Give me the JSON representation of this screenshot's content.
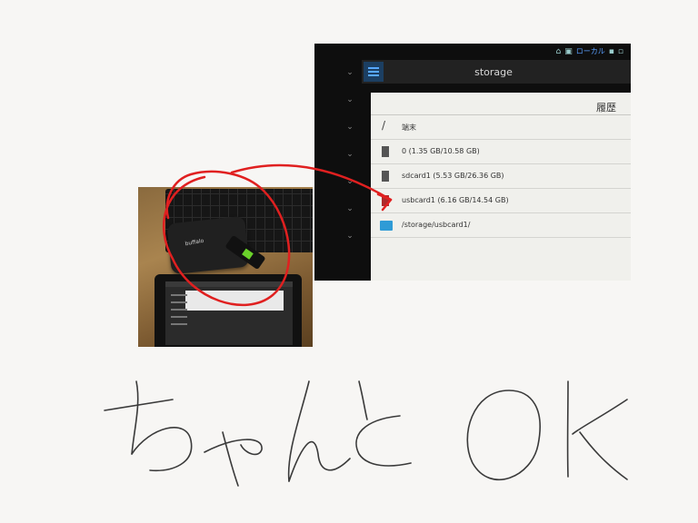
{
  "tablet_window": {
    "status_bar": {
      "text": "ローカル"
    },
    "app_bar": {
      "title": "storage"
    },
    "dialog": {
      "title": "履歴",
      "items": [
        {
          "label": "端末",
          "icon": "slash-icon"
        },
        {
          "label": "0 (1.35 GB/10.58 GB)",
          "icon": "storage-icon"
        },
        {
          "label": "sdcard1 (5.53 GB/26.36 GB)",
          "icon": "sdcard-icon"
        },
        {
          "label": "usbcard1 (6.16 GB/14.54 GB)",
          "icon": "sdcard-icon"
        },
        {
          "label": "/storage/usbcard1/",
          "icon": "folder-icon"
        }
      ]
    }
  },
  "photo": {
    "brand": "buffalo"
  },
  "handwriting": {
    "text": "ちゃんとOk"
  },
  "annotation": {
    "color": "#e02020"
  }
}
